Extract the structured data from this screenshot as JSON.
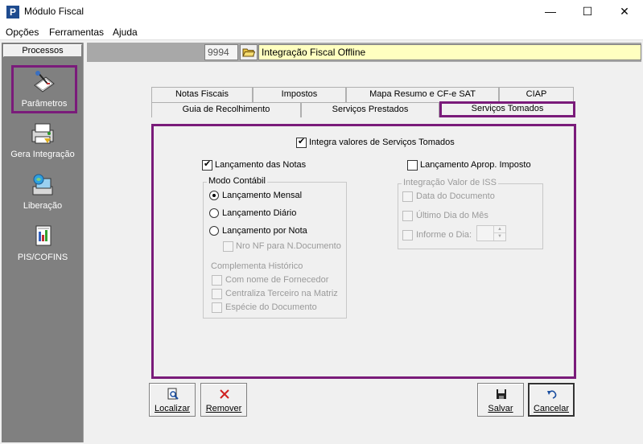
{
  "window": {
    "title": "Módulo Fiscal",
    "minimize_glyph": "—",
    "maximize_glyph": "☐",
    "close_glyph": "✕"
  },
  "menu": [
    "Opções",
    "Ferramentas",
    "Ajuda"
  ],
  "processos": {
    "header": "Processos",
    "items": [
      {
        "label": "Parâmetros",
        "icon": "parametros-icon"
      },
      {
        "label": "Gera Integração",
        "icon": "gera-integracao-icon"
      },
      {
        "label": "Liberação",
        "icon": "liberacao-icon"
      },
      {
        "label": "PIS/COFINS",
        "icon": "pis-cofins-icon"
      }
    ]
  },
  "toolbar": {
    "code": "9994",
    "title": "Integração Fiscal Offline"
  },
  "tabs": {
    "row1": [
      "Notas Fiscais",
      "Impostos",
      "Mapa Resumo e CF-e SAT",
      "CIAP"
    ],
    "row2": [
      "Guia de Recolhimento",
      "Serviços Prestados",
      "Serviços Tomados"
    ],
    "active": "Serviços Tomados"
  },
  "servicos_tomados": {
    "integra": {
      "label": "Integra valores de Serviços Tomados",
      "checked": true
    },
    "lancamento_notas": {
      "label": "Lançamento das Notas",
      "checked": true
    },
    "lancamento_aprop": {
      "label": "Lançamento Aprop. Imposto",
      "checked": false
    },
    "modo_contabil": {
      "title": "Modo Contábil",
      "options": [
        "Lançamento Mensal",
        "Lançamento Diário",
        "Lançamento por Nota"
      ],
      "selected": "Lançamento Mensal",
      "nro_nf": "Nro NF para N.Documento"
    },
    "complementa": {
      "title": "Complementa Histórico",
      "options": [
        "Com nome de Fornecedor",
        "Centraliza Terceiro na Matriz",
        "Espécie do Documento"
      ]
    },
    "integracao_iss": {
      "title": "Integração Valor de ISS",
      "options": [
        "Data do Documento",
        "Último Dia do Mês",
        "Informe o Dia:"
      ]
    }
  },
  "buttons": {
    "localizar": "Localizar",
    "remover": "Remover",
    "salvar": "Salvar",
    "cancelar": "Cancelar"
  },
  "colors": {
    "highlight": "#7a1b7a",
    "title_box": "#ffffc0",
    "left_panel": "#808080"
  }
}
